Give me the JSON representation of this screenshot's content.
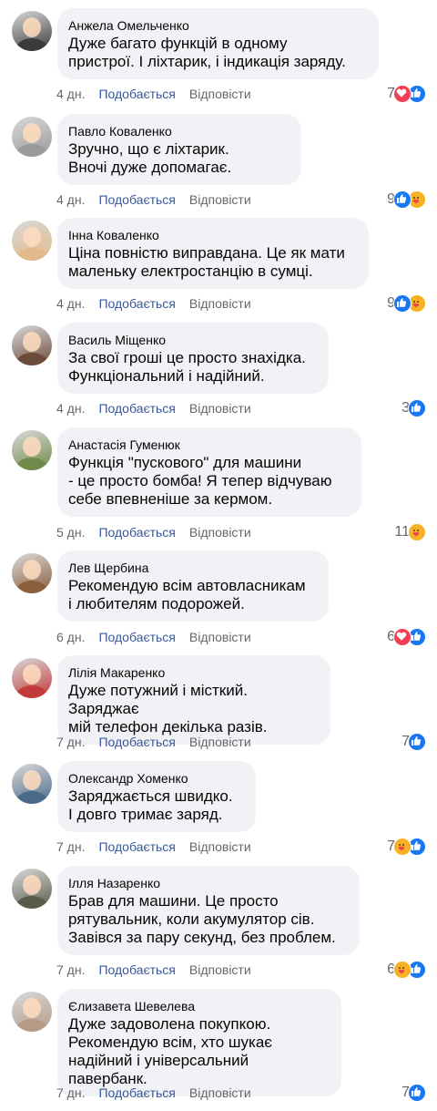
{
  "actions": {
    "like_label": "Подобається",
    "reply_label": "Відповісти"
  },
  "colors": {
    "like": "#1877f2",
    "love": "#f33e58",
    "care": "#f7b125",
    "link": "#385898"
  },
  "comments": [
    {
      "author": "Анжела Омельченко",
      "text": "Дуже багато функцій в одному\nпристрої. І ліхтарик, і індикація заряду.",
      "time": "4 дн.",
      "count": "7",
      "reactions": [
        "love-icon",
        "like-icon"
      ],
      "avatar": "#3b3b3b"
    },
    {
      "author": "Павло Коваленко",
      "text": "Зручно, що є ліхтарик.\nВночі дуже допомагає.",
      "time": "4 дн.",
      "count": "9",
      "reactions": [
        "like-icon",
        "care-icon"
      ],
      "avatar": "#9a9a9a"
    },
    {
      "author": "Інна Коваленко",
      "text": "Ціна повністю виправдана. Це як мати\nмаленьку електростанцію в сумці.",
      "time": "4 дн.",
      "count": "9",
      "reactions": [
        "like-icon",
        "care-icon"
      ],
      "avatar": "#e1b98a"
    },
    {
      "author": "Василь Міщенко",
      "text": "За свої гроші це просто знахідка.\nФункціональний і надійний.",
      "time": "4 дн.",
      "count": "3",
      "reactions": [
        "like-icon"
      ],
      "avatar": "#6b4a3a"
    },
    {
      "author": "Анастасія Гуменюк",
      "text": "Функція \"пускового\" для машини\n- це просто бомба! Я тепер відчуваю\nсебе впевненіше за кермом.",
      "time": "5 дн.",
      "count": "11",
      "reactions": [
        "care-icon"
      ],
      "avatar": "#6f8a4a"
    },
    {
      "author": "Лев Щербина",
      "text": "Рекомендую всім автовласникам\nі любителям подорожей.",
      "time": "6 дн.",
      "count": "6",
      "reactions": [
        "love-icon",
        "like-icon"
      ],
      "avatar": "#8b5e3c"
    },
    {
      "author": "Лілія Макаренко",
      "text": "Дуже потужний і місткий. Заряджає\nмій телефон декілька разів.",
      "time": "7 дн.",
      "count": "7",
      "reactions": [
        "like-icon"
      ],
      "avatar": "#c23a3a"
    },
    {
      "author": "Олександр Хоменко",
      "text": "Заряджається швидко.\nІ довго тримає заряд.",
      "time": "7 дн.",
      "count": "7",
      "reactions": [
        "care-icon",
        "like-icon"
      ],
      "avatar": "#4a6a8a"
    },
    {
      "author": "Ілля Назаренко",
      "text": "Брав для машини. Це просто\nрятувальник, коли акумулятор сів.\nЗавівся за пару секунд, без проблем.",
      "time": "7 дн.",
      "count": "6",
      "reactions": [
        "care-icon",
        "like-icon"
      ],
      "avatar": "#5a5a4a"
    },
    {
      "author": "Єлизавета Шевелева",
      "text": "Дуже задоволена покупкою.\nРекомендую всім, хто шукає\nнадійний і універсальний павербанк.",
      "time": "7 дн.",
      "count": "7",
      "reactions": [
        "like-icon"
      ],
      "avatar": "#b59a86"
    }
  ]
}
